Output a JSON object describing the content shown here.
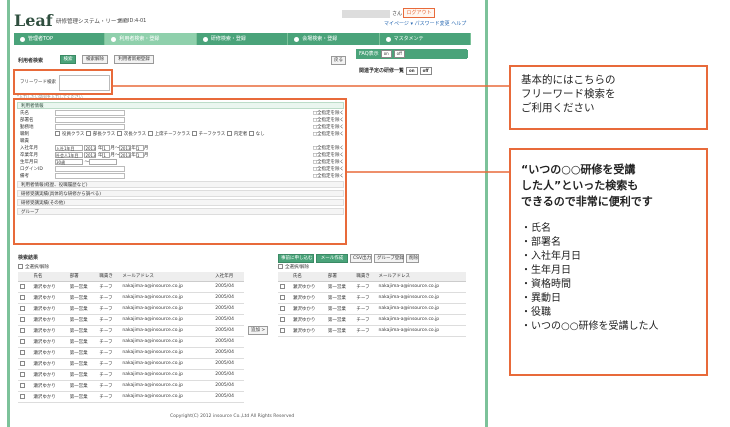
{
  "app": {
    "logo": "Leaf",
    "system_name": "研修管理システム・リーフ・",
    "screen_id": "画面ID:4-01",
    "user_suffix": "さん",
    "logout": "ログアウト",
    "my_page": "マイページ",
    "password_change": "パスワード変更",
    "help": "ヘルプ"
  },
  "tabs": [
    "管理者TOP",
    "利用者検索・登録",
    "研修検索・登録",
    "会場検索・登録",
    "マスタメンテ"
  ],
  "search": {
    "title": "利用者検索",
    "btn_search": "検索",
    "btn_clear": "検索解除",
    "btn_batch": "利用者新規登録",
    "back": "戻る",
    "freeword_label": "フリーワード検索",
    "hint": "*入力したい語句を入力してください"
  },
  "faq": {
    "label": "FAQ表示",
    "on": "on",
    "off": "off",
    "related": "関連予定の研修一覧"
  },
  "form": {
    "header": "利用者情報",
    "include_note": "□全指定を除く",
    "rows": [
      "氏名",
      "部署名",
      "勤務地",
      "職制",
      "職責",
      "入社年月",
      "卒業年月",
      "生年月日",
      "ログインID",
      "備考"
    ],
    "roles": [
      "役員クラス",
      "部長クラス",
      "次長クラス",
      "上席チーフクラス",
      "チーフクラス",
      "内定者",
      "なし"
    ],
    "join_from": "入社1年目",
    "year1": "2013",
    "month1": "1",
    "to": "月〜",
    "year2": "2013",
    "month2": "1",
    "grad_from": "社会人1年目",
    "birth_from": "30歳",
    "birth_to": "〜",
    "sections": [
      "利用者情報(経歴、役職履歴など)",
      "研修受講実績(具体的な研修から調べる)",
      "研修受講実績(その他)",
      "グループ"
    ]
  },
  "results": {
    "title": "検索結果",
    "all": "全選択/解除",
    "headers": [
      "氏名",
      "部署",
      "職責き",
      "メールアドレス",
      "入社年月"
    ],
    "name": "瀬沢ゆかり",
    "dept": "第一営業",
    "role": "チーフ",
    "email": "nakajima-a@insource.co.jp",
    "date": "2005/04",
    "add": "追加 >",
    "right_btns": [
      "事前に申し込む",
      "メール作成",
      "CSV出力",
      "グループ登録",
      "削除"
    ]
  },
  "callout1": {
    "lines": [
      "基本的にはこちらの",
      "フリーワード検索を",
      "ご利用ください"
    ]
  },
  "callout2": {
    "head_lines": [
      "“いつの○○研修を受講",
      "した人”といった検索も",
      "できるので非常に便利です"
    ],
    "items": [
      "・氏名",
      "・部署名",
      "・入社年月日",
      "・生年月日",
      "・資格時間",
      "・異動日",
      "・役職",
      "・いつの○○研修を受講した人"
    ]
  },
  "footer": "Copyright(C) 2012 insource Co.,Ltd All Rights Reserved"
}
